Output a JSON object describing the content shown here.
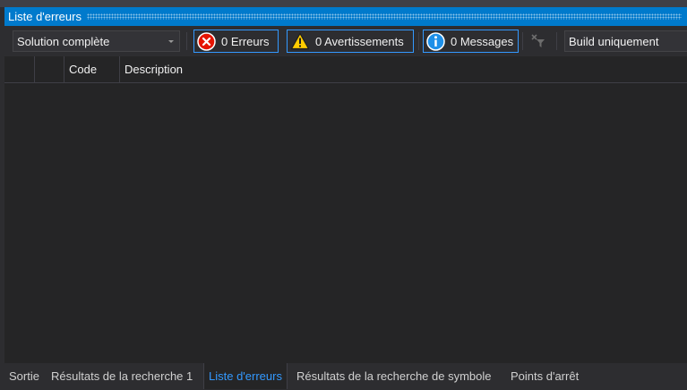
{
  "panel": {
    "title": "Liste d'erreurs"
  },
  "toolbar": {
    "scope_value": "Solution complète",
    "errors_label": "0 Erreurs",
    "warnings_label": "0 Avertissements",
    "messages_label": "0 Messages",
    "build_value": "Build uniquement",
    "icons": {
      "errors": "error-circle-icon",
      "warnings": "warning-triangle-icon",
      "messages": "info-circle-icon",
      "clear_filter": "clear-filter-icon"
    },
    "colors": {
      "error": "#e51400",
      "warning": "#ffcc00",
      "info": "#1e90e8",
      "accent": "#007acc"
    }
  },
  "grid": {
    "columns": [
      "",
      "",
      "Code",
      "Description"
    ]
  },
  "tabs": [
    {
      "label": "Sortie",
      "active": false
    },
    {
      "label": "Résultats de la recherche 1",
      "active": false
    },
    {
      "label": "Liste d'erreurs",
      "active": true
    },
    {
      "label": "Résultats de la recherche de symbole",
      "active": false
    },
    {
      "label": "Points d'arrêt",
      "active": false
    }
  ]
}
